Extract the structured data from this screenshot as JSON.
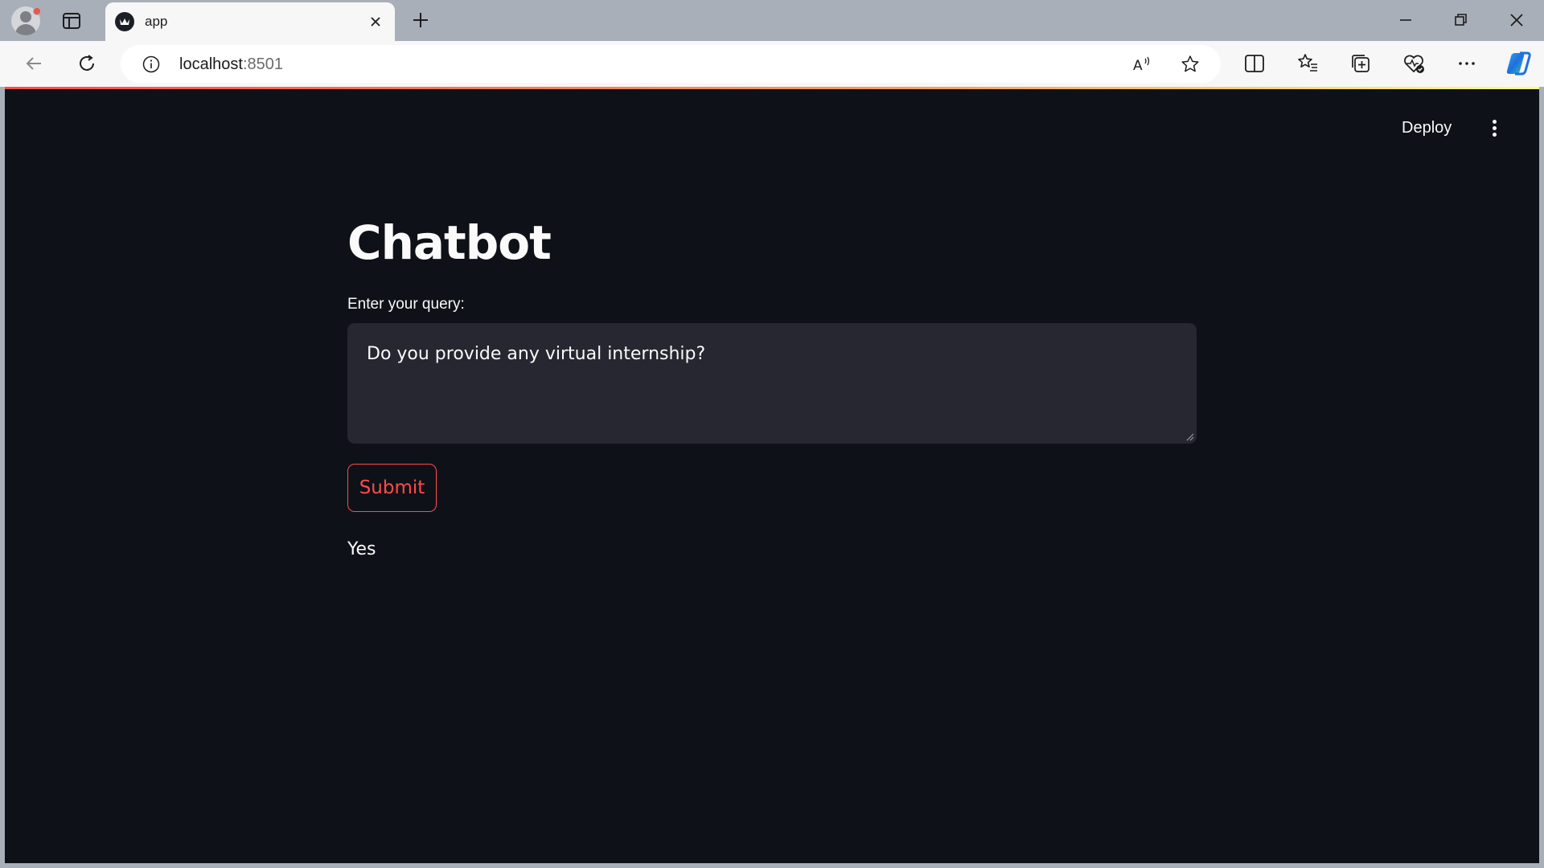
{
  "browser": {
    "tab": {
      "title": "app"
    },
    "address": {
      "host": "localhost",
      "port": ":8501"
    }
  },
  "app": {
    "header": {
      "deploy_label": "Deploy"
    },
    "title": "Chatbot",
    "query": {
      "label": "Enter your query:",
      "value": "Do you provide any virtual internship?"
    },
    "submit_label": "Submit",
    "response": "Yes"
  },
  "colors": {
    "app_background": "#0e1117",
    "input_background": "#262730",
    "accent": "#ff4b4b",
    "text": "#fafafa"
  },
  "icons": [
    "profile-icon",
    "tab-actions-icon",
    "app-favicon-icon",
    "close-icon",
    "plus-icon",
    "minimize-icon",
    "restore-icon",
    "back-icon",
    "refresh-icon",
    "info-icon",
    "read-aloud-icon",
    "favorite-star-icon",
    "split-screen-icon",
    "favorites-icon",
    "collections-icon",
    "browser-essentials-icon",
    "more-icon",
    "copilot-icon",
    "kebab-menu-icon"
  ]
}
